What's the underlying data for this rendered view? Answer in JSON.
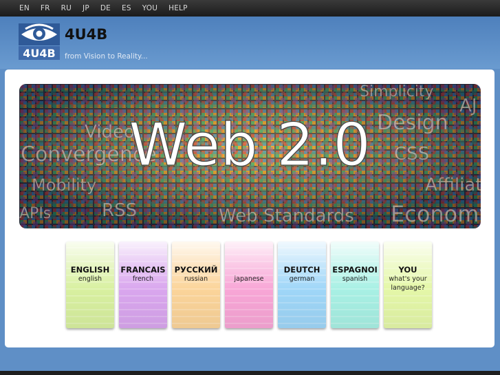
{
  "topnav": {
    "items": [
      {
        "label": "EN"
      },
      {
        "label": "FR"
      },
      {
        "label": "RU"
      },
      {
        "label": "JP"
      },
      {
        "label": "DE"
      },
      {
        "label": "ES"
      },
      {
        "label": "YOU"
      },
      {
        "label": "HELP"
      }
    ]
  },
  "header": {
    "logo_text": "4U4B",
    "brand": "4U4B",
    "tagline": "from Vision to Reality..."
  },
  "banner": {
    "headline": "Web 2.0",
    "words": [
      "Design",
      "Video",
      "Convergence",
      "Mobility",
      "RSS",
      "Web Standards",
      "Economy",
      "CSS",
      "Simplicity",
      "Affiliat",
      "APIs",
      "AJ"
    ]
  },
  "cards": [
    {
      "title": "ENGLISH",
      "subtitle": "english",
      "color": "#d8f0a0"
    },
    {
      "title": "FRANCAIS",
      "subtitle": "french",
      "color": "#d9a6ee"
    },
    {
      "title": "РУССКИЙ",
      "subtitle": "russian",
      "color": "#fbd49a"
    },
    {
      "title": "",
      "subtitle": "japanese",
      "color": "#f8a6d6"
    },
    {
      "title": "DEUTCH",
      "subtitle": "german",
      "color": "#9fd6f8"
    },
    {
      "title": "ESPAGNOI",
      "subtitle": "spanish",
      "color": "#a8f0e4"
    },
    {
      "title": "YOU",
      "subtitle": "what's your language?",
      "color": "#e4f7a8"
    }
  ],
  "colors": {
    "background": "#5f8fc6",
    "topnav": "#232323",
    "panel": "#ffffff"
  }
}
